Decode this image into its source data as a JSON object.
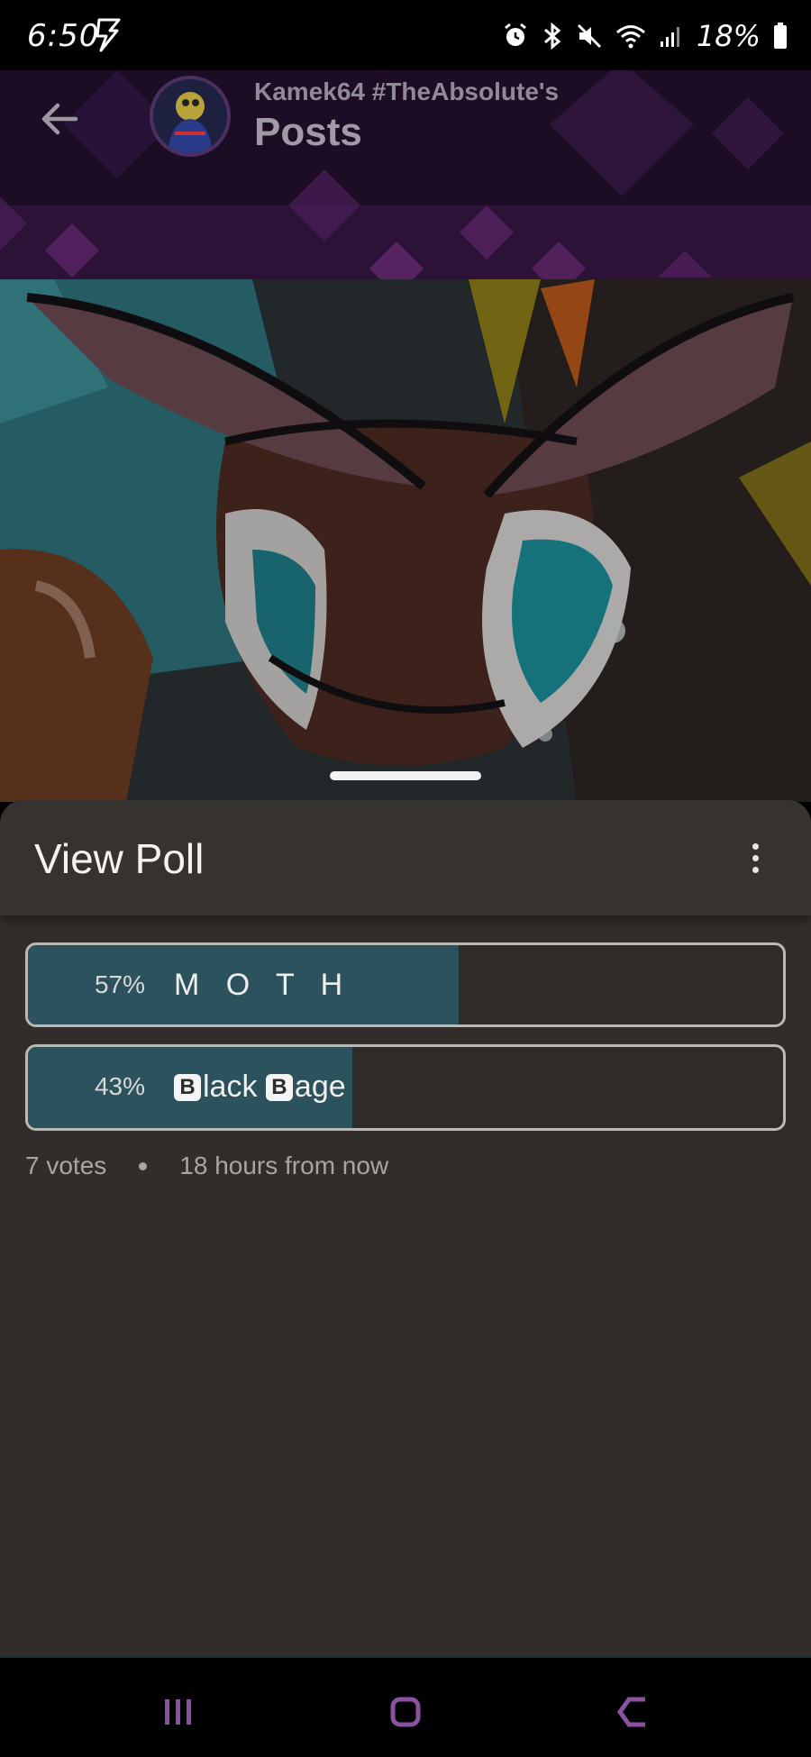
{
  "status_bar": {
    "time": "6:50",
    "battery_percent": "18%",
    "icons": [
      "bolt-icon",
      "alarm-icon",
      "bluetooth-icon",
      "mute-icon",
      "wifi-icon",
      "signal-icon",
      "battery-icon"
    ]
  },
  "header": {
    "subtitle": "Kamek64 #TheAbsolute's",
    "title": "Posts",
    "back_icon": "arrow-left-icon"
  },
  "sheet": {
    "title": "View Poll",
    "menu_icon": "more-vertical-icon"
  },
  "poll": {
    "options": [
      {
        "percent_label": "57%",
        "percent": 57,
        "label": "M O T H"
      },
      {
        "percent_label": "43%",
        "percent": 43,
        "label_badge_1": "B",
        "label_part_1": "lack ",
        "label_badge_2": "B",
        "label_part_2": "age"
      }
    ],
    "votes": "7 votes",
    "time_left": "18 hours from now"
  },
  "nav_bar": {
    "buttons": [
      "recent-apps-icon",
      "home-icon",
      "back-icon"
    ]
  },
  "colors": {
    "sheet_bg": "#312d2a",
    "poll_fill": "#2c525d",
    "nav_accent": "#7a4a8c"
  }
}
